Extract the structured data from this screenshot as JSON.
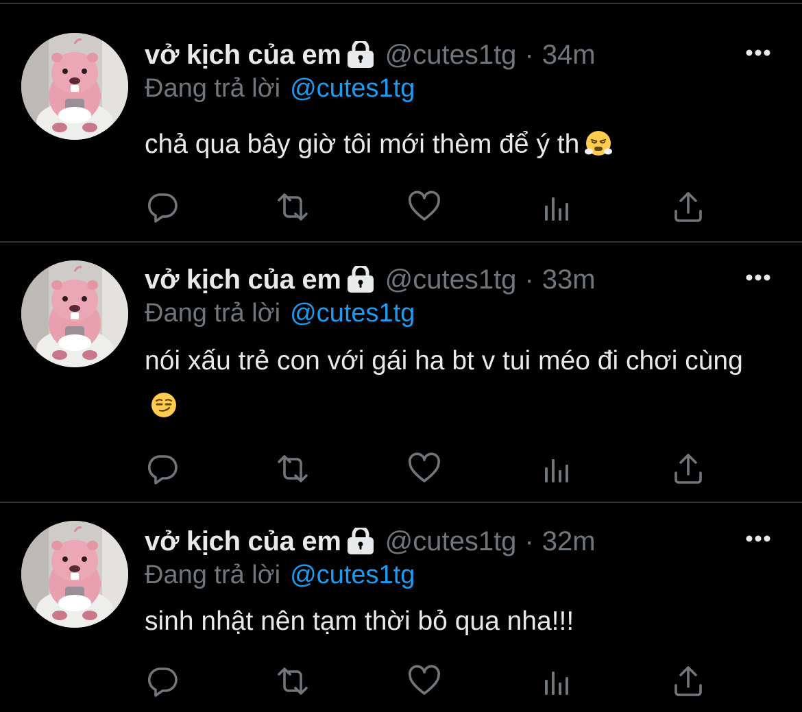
{
  "colors": {
    "background": "#000000",
    "primary_text": "#e7e9ea",
    "secondary_text": "#71767b",
    "accent_blue": "#1d9bf0",
    "divider": "#2f3336"
  },
  "tweets": [
    {
      "display_name": "vở kịch của em",
      "handle": "@cutes1tg",
      "separator": "·",
      "time": "34m",
      "reply_prefix": "Đang trả lời",
      "reply_to": "@cutes1tg",
      "text": "chả qua bây giờ tôi mới thèm để ý th",
      "emoji": "face-with-steam-from-nose",
      "icons": [
        "lock-icon",
        "more-icon",
        "reply-icon",
        "retweet-icon",
        "like-icon",
        "views-icon",
        "share-icon"
      ]
    },
    {
      "display_name": "vở kịch của em",
      "handle": "@cutes1tg",
      "separator": "·",
      "time": "33m",
      "reply_prefix": "Đang trả lời",
      "reply_to": "@cutes1tg",
      "text": "nói xấu trẻ con với gái ha bt v tui méo đi chơi cùng",
      "emoji": "smirking-face",
      "icons": [
        "lock-icon",
        "more-icon",
        "reply-icon",
        "retweet-icon",
        "like-icon",
        "views-icon",
        "share-icon"
      ]
    },
    {
      "display_name": "vở kịch của em",
      "handle": "@cutes1tg",
      "separator": "·",
      "time": "32m",
      "reply_prefix": "Đang trả lời",
      "reply_to": "@cutes1tg",
      "text": "sinh nhật nên tạm thời bỏ qua nha!!!",
      "emoji": "",
      "icons": [
        "lock-icon",
        "more-icon",
        "reply-icon",
        "retweet-icon",
        "like-icon",
        "views-icon",
        "share-icon"
      ]
    }
  ]
}
